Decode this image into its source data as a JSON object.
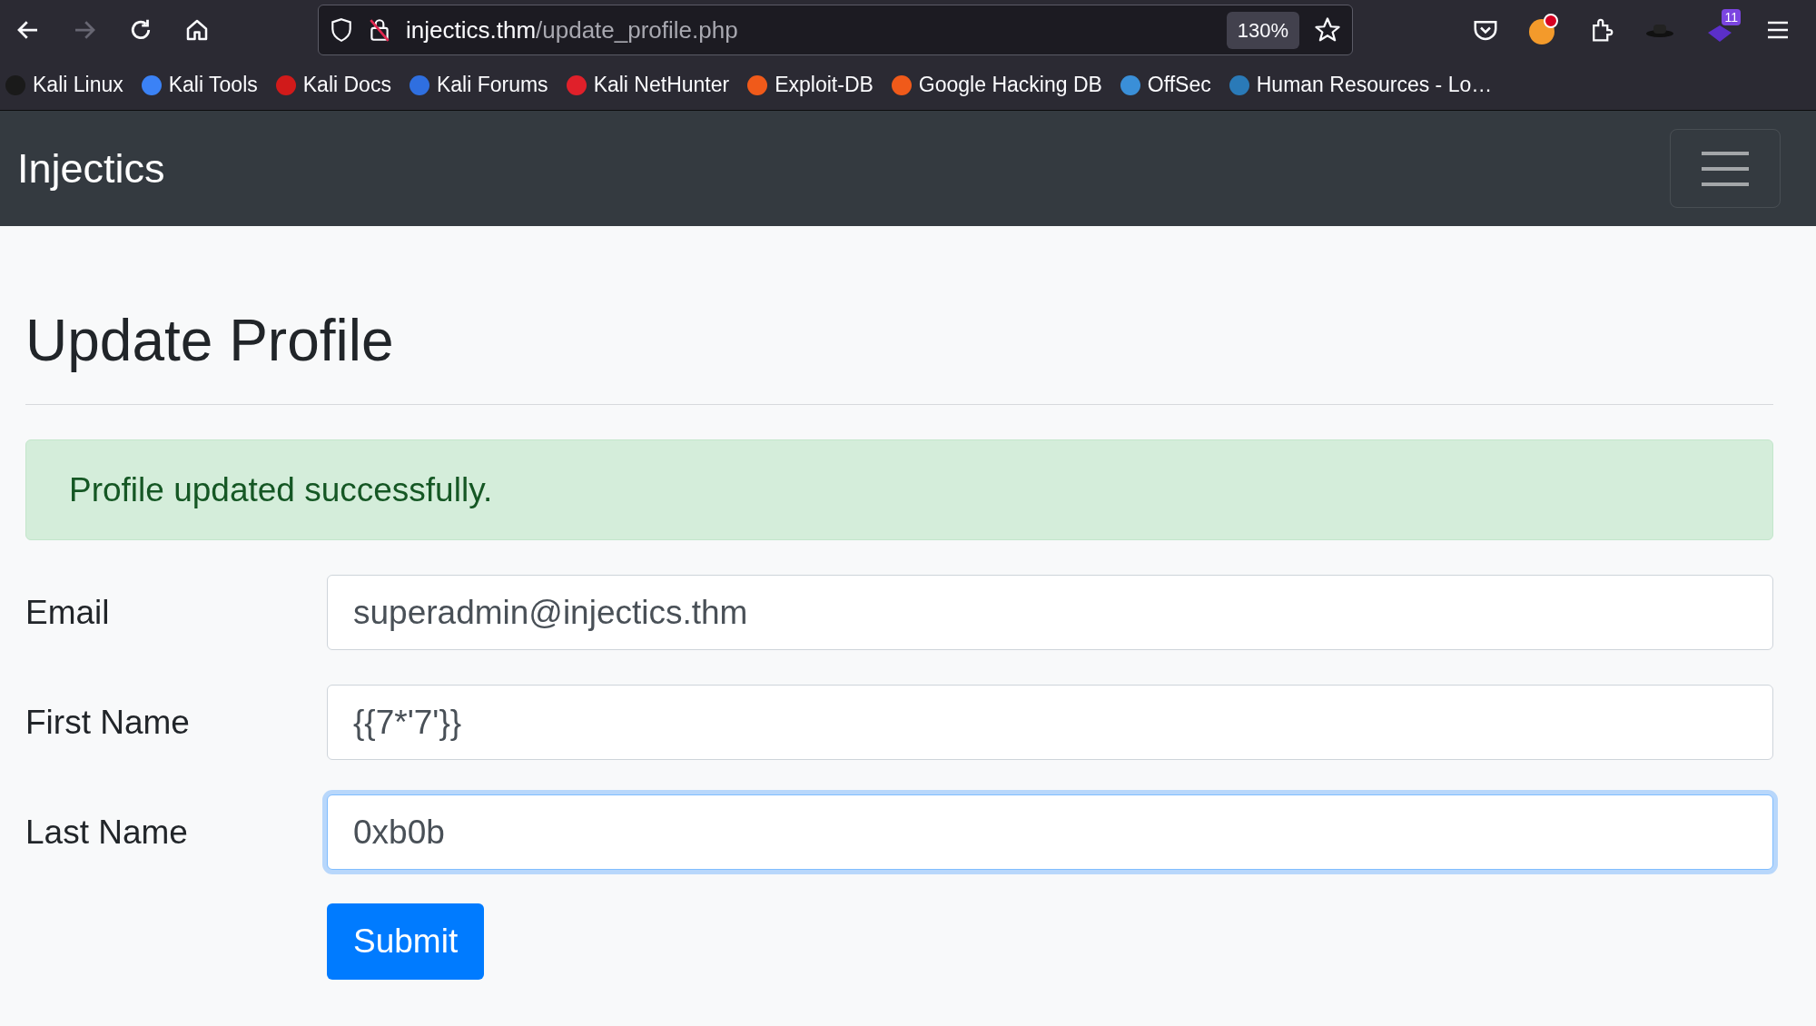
{
  "browser": {
    "nav_buttons": [
      {
        "kind": "back",
        "disabled": false
      },
      {
        "kind": "forward",
        "disabled": true
      },
      {
        "kind": "reload",
        "disabled": false
      },
      {
        "kind": "home",
        "disabled": false
      }
    ],
    "url": {
      "host": "injectics.thm",
      "path": "/update_profile.php"
    },
    "zoom": "130%",
    "extension_badge": "11",
    "bookmarks": [
      {
        "label": "Kali Linux",
        "color": "#1a1a1a"
      },
      {
        "label": "Kali Tools",
        "color": "#3b82f6"
      },
      {
        "label": "Kali Docs",
        "color": "#d11a1a"
      },
      {
        "label": "Kali Forums",
        "color": "#2f6fe0"
      },
      {
        "label": "Kali NetHunter",
        "color": "#e0202a"
      },
      {
        "label": "Exploit-DB",
        "color": "#f05a1a"
      },
      {
        "label": "Google Hacking DB",
        "color": "#f05a1a"
      },
      {
        "label": "OffSec",
        "color": "#3a8fd8"
      },
      {
        "label": "Human Resources - Lo…",
        "color": "#2a7ab8"
      }
    ]
  },
  "navbar": {
    "brand": "Injectics"
  },
  "page": {
    "title": "Update Profile",
    "alert": "Profile updated successfully.",
    "fields": [
      {
        "label": "Email",
        "value": "superadmin@injectics.thm",
        "focused": false
      },
      {
        "label": "First Name",
        "value": "{{7*'7'}}",
        "focused": false
      },
      {
        "label": "Last Name",
        "value": "0xb0b",
        "focused": true
      }
    ],
    "submit": "Submit"
  }
}
